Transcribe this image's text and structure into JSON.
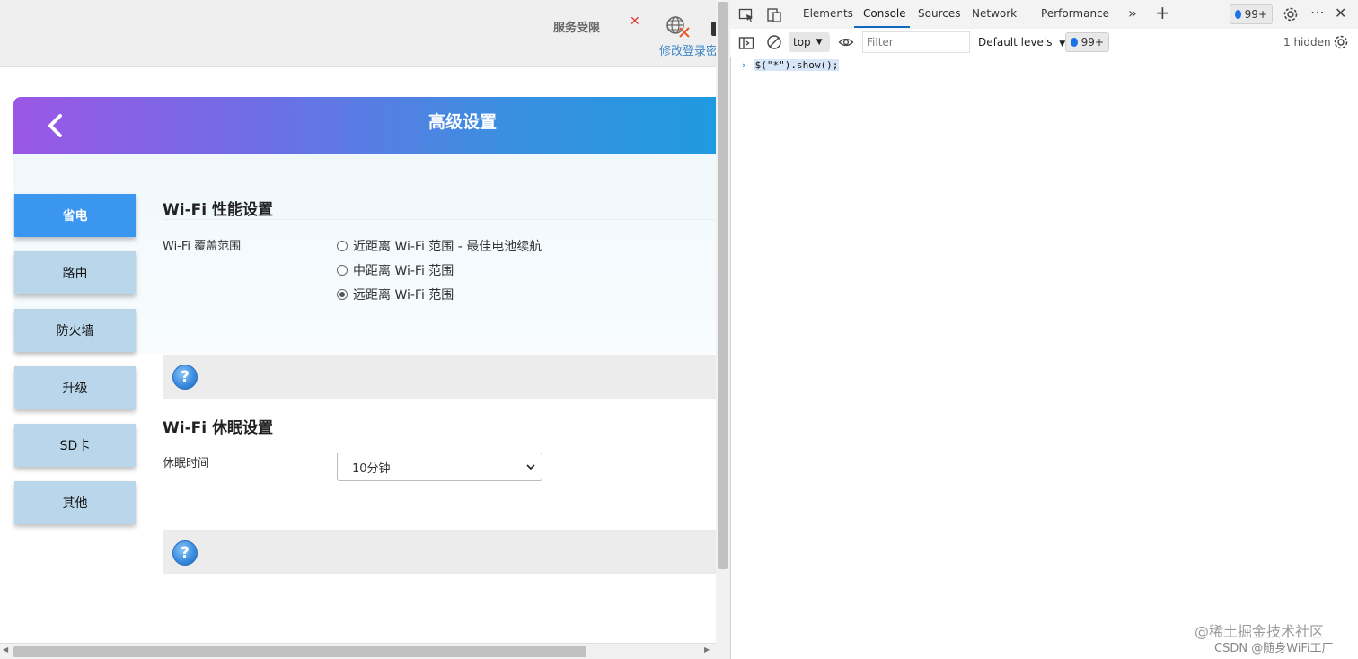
{
  "page": {
    "top_status": {
      "service_text": "服务受限",
      "login_text": "修改登录密"
    },
    "header": {
      "title": "高级设置"
    },
    "nav": [
      {
        "label": "省电",
        "active": true
      },
      {
        "label": "路由",
        "active": false
      },
      {
        "label": "防火墙",
        "active": false
      },
      {
        "label": "升级",
        "active": false
      },
      {
        "label": "SD卡",
        "active": false
      },
      {
        "label": "其他",
        "active": false
      }
    ],
    "wifi_perf": {
      "title": "Wi-Fi 性能设置",
      "coverage_label": "Wi-Fi 覆盖范围",
      "options": [
        {
          "label": "近距离 Wi-Fi 范围 - 最佳电池续航",
          "checked": false
        },
        {
          "label": "中距离 Wi-Fi 范围",
          "checked": false
        },
        {
          "label": "远距离 Wi-Fi 范围",
          "checked": true
        }
      ]
    },
    "wifi_sleep": {
      "title": "Wi-Fi 休眠设置",
      "sleep_label": "休眠时间",
      "sleep_value": "10分钟"
    },
    "help_icon_text": "?"
  },
  "devtools": {
    "tabs": [
      "Elements",
      "Console",
      "Sources",
      "Network",
      "Performance"
    ],
    "active_tab": "Console",
    "badge_count": "99+",
    "context": "top",
    "filter_placeholder": "Filter",
    "levels": "Default levels",
    "hidden": "1 hidden",
    "console_input": "$(\"*\").show();"
  },
  "watermark": {
    "line1": "@稀土掘金技术社区",
    "line2": "CSDN @随身WiFi工厂"
  },
  "colors": {
    "accent": "#3a96ef",
    "nav_bg": "#b9d6ea",
    "devtools_blue": "#0f6cbd"
  }
}
